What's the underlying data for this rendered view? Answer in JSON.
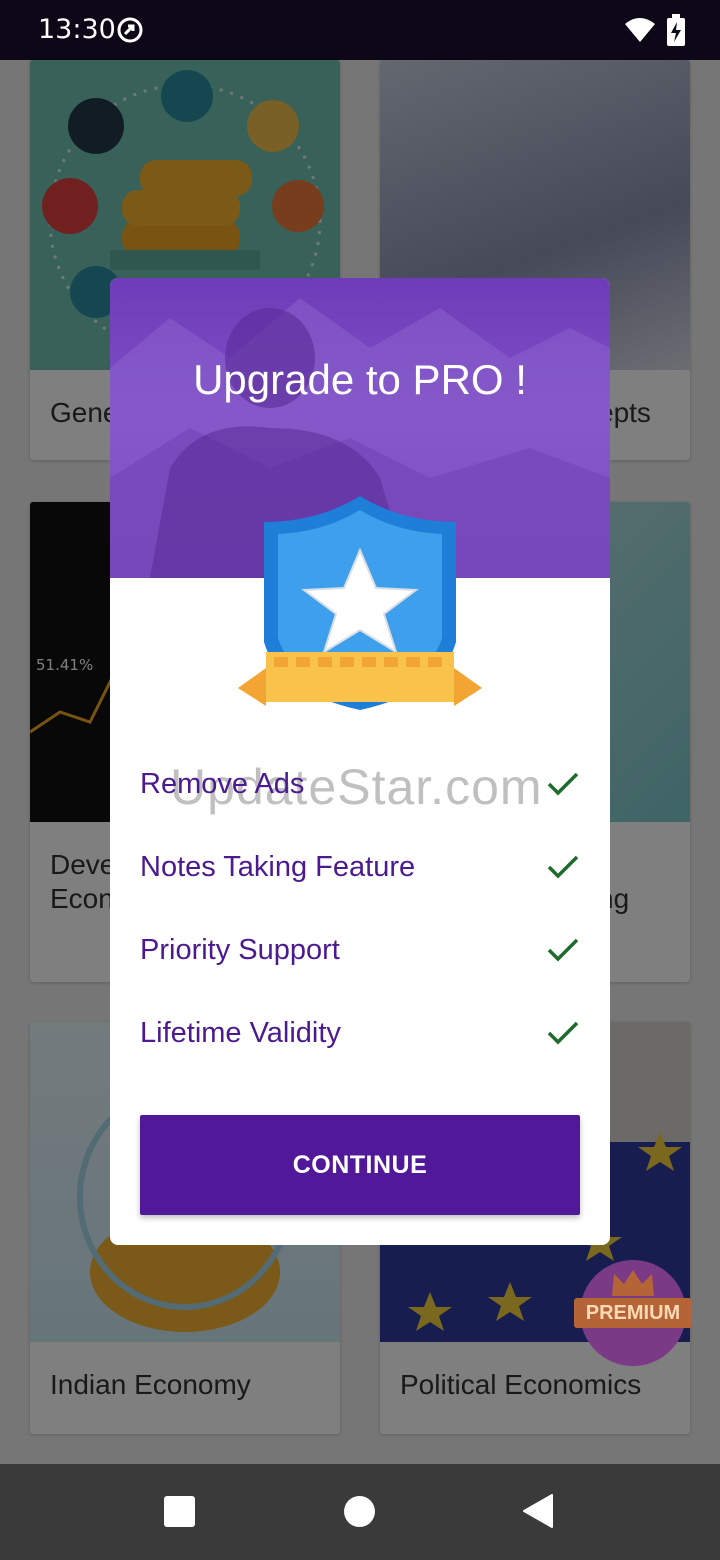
{
  "status_bar": {
    "time": "13:30"
  },
  "background_cards": [
    {
      "label": "Gene"
    },
    {
      "label": "epts"
    },
    {
      "label": "Deve\nEcon"
    },
    {
      "label": "ng"
    },
    {
      "label": "Indian Economy"
    },
    {
      "label": "Political Economics"
    }
  ],
  "card_overlay_text": "51.41%",
  "premium_fab": {
    "label": "PREMIUM"
  },
  "dialog": {
    "title": "Upgrade to PRO !",
    "features": [
      {
        "label": "Remove Ads"
      },
      {
        "label": "Notes Taking Feature"
      },
      {
        "label": "Priority Support"
      },
      {
        "label": "Lifetime Validity"
      }
    ],
    "continue_label": "CONTINUE"
  },
  "watermark": "UpdateStar.com",
  "colors": {
    "accent": "#52189a",
    "feature_text": "#4b1a90",
    "check": "#1e6b2c",
    "hero": "#7e4ec6"
  }
}
